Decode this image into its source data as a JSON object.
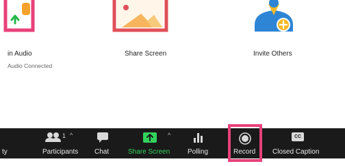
{
  "tiles": {
    "join_audio_label": "in Audio",
    "join_audio_status": "Audio Connected",
    "share_screen_label": "Share Screen",
    "invite_others_label": "Invite Others"
  },
  "toolbar": {
    "truncated_left_label": "ty",
    "participants_label": "Participants",
    "participants_count": "1",
    "chat_label": "Chat",
    "share_screen_label": "Share Screen",
    "polling_label": "Polling",
    "record_label": "Record",
    "closed_caption_label": "Closed Caption",
    "cc_badge": "CC"
  },
  "colors": {
    "toolbar_bg": "#1a1a1a",
    "share_green": "#32d35b",
    "highlight_pink": "#e8417a",
    "invite_blue": "#2e85d6",
    "invite_yellow": "#f6b826",
    "share_icon_red": "#e0505a"
  }
}
